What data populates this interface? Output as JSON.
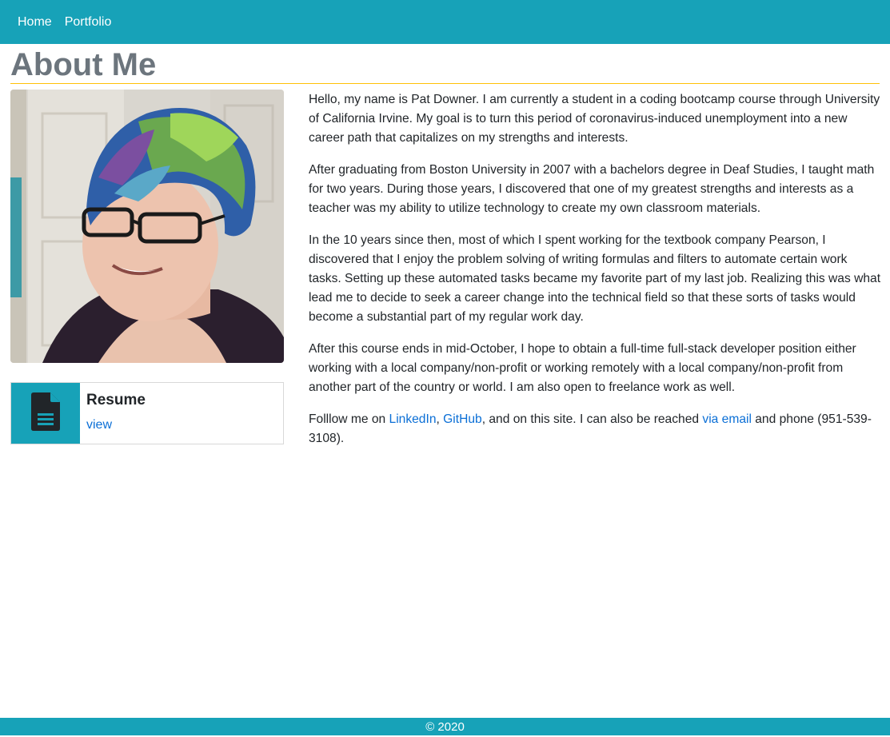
{
  "nav": {
    "items": [
      {
        "label": "Home"
      },
      {
        "label": "Portfolio"
      }
    ]
  },
  "page": {
    "title": "About Me"
  },
  "resume": {
    "title": "Resume",
    "link_label": "view",
    "icon": "document-icon"
  },
  "about": {
    "p1": "Hello, my name is Pat Downer. I am currently a student in a coding bootcamp course through University of California Irvine. My goal is to turn this period of coronavirus-induced unemployment into a new career path that capitalizes on my strengths and interests.",
    "p2": "After graduating from Boston University in 2007 with a bachelors degree in Deaf Studies, I taught math for two years. During those years, I discovered that one of my greatest strengths and interests as a teacher was my ability to utilize technology to create my own classroom materials.",
    "p3": "In the 10 years since then, most of which I spent working for the textbook company Pearson, I discovered that I enjoy the problem solving of writing formulas and filters to automate certain work tasks. Setting up these automated tasks became my favorite part of my last job. Realizing this was what lead me to decide to seek a career change into the technical field so that these sorts of tasks would become a substantial part of my regular work day.",
    "p4": "After this course ends in mid-October, I hope to obtain a full-time full-stack developer position either working with a local company/non-profit or working remotely with a local company/non-profit from another part of the country or world. I am also open to freelance work as well.",
    "p5": {
      "prefix": "Folllow me on ",
      "linkedin": "LinkedIn",
      "sep1": ", ",
      "github": "GitHub",
      "mid": ", and on this site. I can also be reached ",
      "email": "via email",
      "suffix": " and phone (951-539-3108)."
    }
  },
  "footer": {
    "text": "© 2020"
  },
  "colors": {
    "primary": "#17a2b8",
    "title": "#6c757d",
    "rule": "#ffc107",
    "link": "#0b6fd6"
  }
}
